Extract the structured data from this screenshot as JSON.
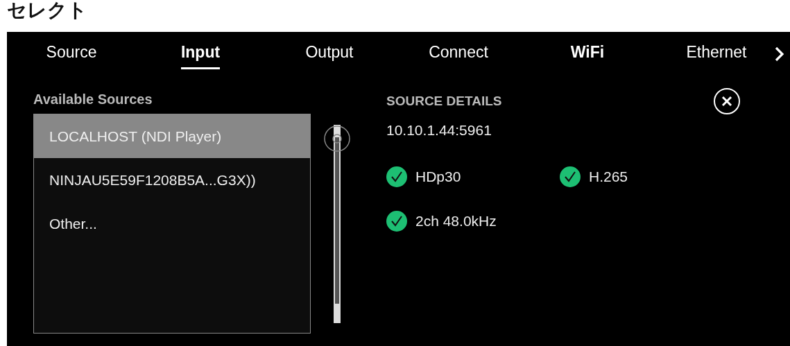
{
  "page_title": "セレクト",
  "tabs": [
    {
      "label": "Source",
      "selected": false,
      "emphasized": false
    },
    {
      "label": "Input",
      "selected": true,
      "emphasized": true
    },
    {
      "label": "Output",
      "selected": false,
      "emphasized": false
    },
    {
      "label": "Connect",
      "selected": false,
      "emphasized": false
    },
    {
      "label": "WiFi",
      "selected": false,
      "emphasized": true
    },
    {
      "label": "Ethernet",
      "selected": false,
      "emphasized": false
    }
  ],
  "sources": {
    "title": "Available Sources",
    "items": [
      {
        "label": "LOCALHOST (NDI Player)",
        "selected": true
      },
      {
        "label": "NINJAU5E59F1208B5A...G3X))",
        "selected": false
      },
      {
        "label": "Other...",
        "selected": false
      }
    ]
  },
  "details": {
    "title": "SOURCE DETAILS",
    "address": "10.10.1.44:5961",
    "features": [
      {
        "label": "HDp30",
        "ok": true
      },
      {
        "label": "H.265",
        "ok": true
      },
      {
        "label": "2ch 48.0kHz",
        "ok": true
      }
    ]
  }
}
